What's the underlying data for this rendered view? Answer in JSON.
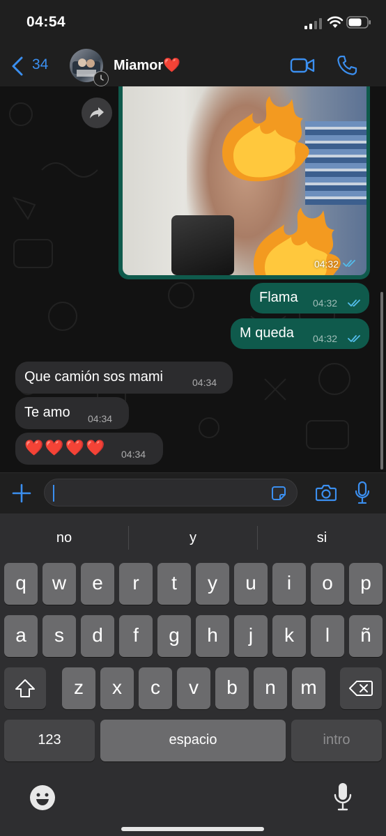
{
  "status_bar": {
    "time": "04:54"
  },
  "header": {
    "back_count": "34",
    "contact_name": "Miamor❤️"
  },
  "messages": [
    {
      "type": "image",
      "direction": "outgoing",
      "time": "04:32",
      "status": "read"
    },
    {
      "type": "text",
      "direction": "outgoing",
      "text": "Flama",
      "time": "04:32",
      "status": "read"
    },
    {
      "type": "text",
      "direction": "outgoing",
      "text": "M queda",
      "time": "04:32",
      "status": "read"
    },
    {
      "type": "text",
      "direction": "incoming",
      "text": "Que camión sos mami",
      "time": "04:34"
    },
    {
      "type": "text",
      "direction": "incoming",
      "text": "Te amo",
      "time": "04:34"
    },
    {
      "type": "text",
      "direction": "incoming",
      "text": "❤️❤️❤️❤️",
      "time": "04:34"
    }
  ],
  "input": {
    "value": ""
  },
  "keyboard": {
    "suggestions": [
      "no",
      "y",
      "si"
    ],
    "row1": [
      "q",
      "w",
      "e",
      "r",
      "t",
      "y",
      "u",
      "i",
      "o",
      "p"
    ],
    "row2": [
      "a",
      "s",
      "d",
      "f",
      "g",
      "h",
      "j",
      "k",
      "l",
      "ñ"
    ],
    "row3": [
      "z",
      "x",
      "c",
      "v",
      "b",
      "n",
      "m"
    ],
    "numbers_label": "123",
    "space_label": "espacio",
    "return_label": "intro"
  },
  "colors": {
    "accent": "#3b8ff0",
    "outgoing_bubble": "#0f5a4c",
    "incoming_bubble": "#2c2c2e",
    "read_ticks": "#53bdeb"
  },
  "icons": [
    "back-chevron-icon",
    "video-call-icon",
    "phone-icon",
    "forward-icon",
    "fire-icon",
    "plus-icon",
    "sticker-icon",
    "camera-icon",
    "mic-icon",
    "shift-icon",
    "backspace-icon",
    "emoji-icon",
    "dictation-icon"
  ]
}
